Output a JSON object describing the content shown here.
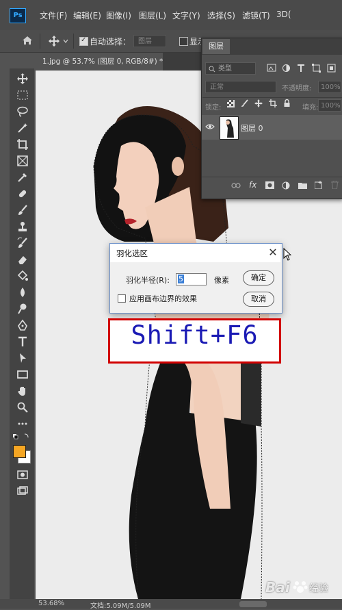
{
  "menubar": {
    "logo": "Ps",
    "items": [
      "文件(F)",
      "编辑(E)",
      "图像(I)",
      "图层(L)",
      "文字(Y)",
      "选择(S)",
      "滤镜(T)",
      "3D("
    ]
  },
  "options_bar": {
    "auto_select_label": "自动选择：",
    "auto_select_value": "图层",
    "show_transform_label": "显示"
  },
  "document_tab": {
    "title": "1.jpg @ 53.7% (图层 0, RGB/8#) *",
    "close": "×"
  },
  "layers_panel": {
    "tab_label": "图层",
    "filter_placeholder": "类型",
    "blend_mode": "正常",
    "opacity_label": "不透明度:",
    "opacity_value": "100%",
    "lock_label": "锁定:",
    "fill_label": "填充:",
    "fill_value": "100%",
    "layer_name": "图层 0",
    "footer_fx": "fx"
  },
  "feather_dialog": {
    "title": "羽化选区",
    "radius_label": "羽化半径(R):",
    "radius_value": "5",
    "radius_unit": "像素",
    "ok_label": "确定",
    "cancel_label": "取消",
    "canvas_bounds_label": "应用画布边界的效果",
    "close": "✕"
  },
  "shortcut_overlay": {
    "text": "Shift+F6"
  },
  "status_bar": {
    "zoom": "53.68%",
    "doc_size": "文档:5.09M/5.09M"
  },
  "watermark": {
    "text": "Bai",
    "text2": "经验"
  },
  "colors": {
    "foreground": "#f5a623",
    "background": "#ffffff",
    "highlight_border": "#d10000",
    "shortcut_text": "#1a1ab4"
  }
}
